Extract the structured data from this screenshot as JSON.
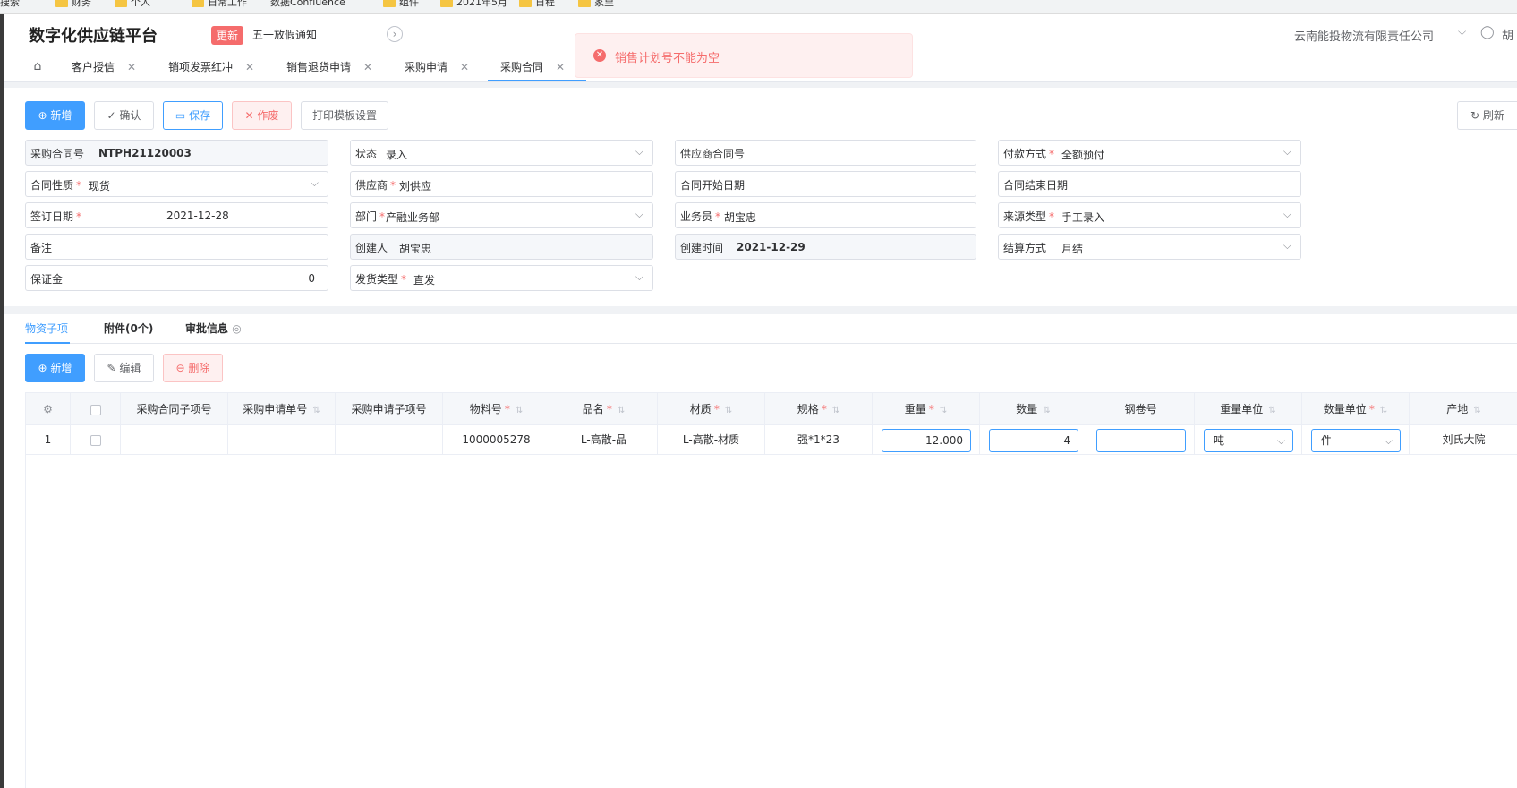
{
  "bookmarks": [
    "搜索",
    "财务",
    "个人",
    "日常工作",
    "数据Confluence",
    "组件",
    "2021年5月",
    "日程",
    "家里"
  ],
  "header": {
    "title": "数字化供应链平台",
    "update_badge": "更新",
    "notice": "五一放假通知",
    "company": "云南能投物流有限责任公司",
    "user": "胡"
  },
  "tabs": [
    {
      "label": "客户授信"
    },
    {
      "label": "销项发票红冲"
    },
    {
      "label": "销售退货申请"
    },
    {
      "label": "采购申请"
    },
    {
      "label": "采购合同"
    }
  ],
  "toast": {
    "message": "销售计划号不能为空"
  },
  "toolbar": {
    "new": "新增",
    "confirm": "确认",
    "save": "保存",
    "void": "作废",
    "print_settings": "打印模板设置",
    "refresh": "刷新"
  },
  "form": {
    "contract_no": {
      "label": "采购合同号",
      "value": "NTPH21120003"
    },
    "status": {
      "label": "状态",
      "value": "录入"
    },
    "supplier_contract_no": {
      "label": "供应商合同号",
      "value": ""
    },
    "payment_method": {
      "label": "付款方式",
      "value": "全额预付"
    },
    "contract_nature": {
      "label": "合同性质",
      "value": "现货"
    },
    "supplier": {
      "label": "供应商",
      "value": "刘供应"
    },
    "contract_start": {
      "label": "合同开始日期",
      "value": ""
    },
    "contract_end": {
      "label": "合同结束日期",
      "value": ""
    },
    "sign_date": {
      "label": "签订日期",
      "value": "2021-12-28"
    },
    "department": {
      "label": "部门",
      "value": "产融业务部"
    },
    "salesman": {
      "label": "业务员",
      "value": "胡宝忠"
    },
    "source_type": {
      "label": "来源类型",
      "value": "手工录入"
    },
    "remark": {
      "label": "备注",
      "value": ""
    },
    "creator": {
      "label": "创建人",
      "value": "胡宝忠"
    },
    "created_time": {
      "label": "创建时间",
      "value": "2021-12-29"
    },
    "settlement": {
      "label": "结算方式",
      "value": "月结"
    },
    "deposit": {
      "label": "保证金",
      "value": "0"
    },
    "delivery_type": {
      "label": "发货类型",
      "value": "直发"
    }
  },
  "subtabs": {
    "items": "物资子项",
    "attachments": "附件(0个)",
    "approval": "审批信息"
  },
  "grid_toolbar": {
    "new": "新增",
    "edit": "编辑",
    "delete": "删除"
  },
  "columns": {
    "sub_item": "采购合同子项号",
    "request_no": "采购申请单号",
    "request_sub": "采购申请子项号",
    "material_no": "物料号",
    "product_name": "品名",
    "material": "材质",
    "spec": "规格",
    "weight": "重量",
    "quantity": "数量",
    "coil_no": "钢卷号",
    "weight_unit": "重量单位",
    "qty_unit": "数量单位",
    "origin": "产地"
  },
  "rows": [
    {
      "index": "1",
      "sub_item": "",
      "request_no": "",
      "request_sub": "",
      "material_no": "1000005278",
      "product_name": "L-高散-品",
      "material": "L-高散-材质",
      "spec": "强*1*23",
      "weight": "12.000",
      "quantity": "4",
      "coil_no": "",
      "weight_unit": "吨",
      "qty_unit": "件",
      "origin": "刘氏大院"
    }
  ],
  "colors": {
    "primary": "#409eff",
    "danger": "#f56c6c",
    "update_badge": "#f56c6c"
  }
}
